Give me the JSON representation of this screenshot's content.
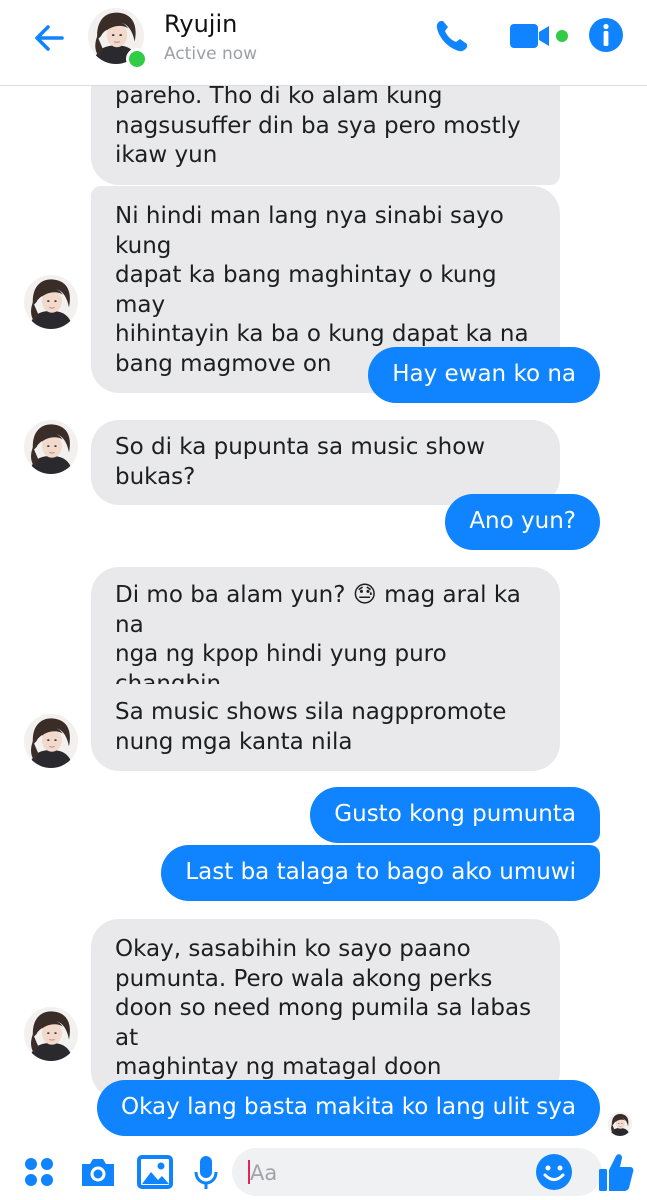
{
  "header": {
    "name": "Ryujin",
    "status": "Active now",
    "accent": "#0f84fe",
    "online_color": "#31cc46"
  },
  "messages": [
    {
      "side": "in",
      "text": "pareho. Tho di ko alam kung\nnagsusuffer din ba sya pero mostly\nikaw yun"
    },
    {
      "side": "in",
      "text": "Ni hindi man lang nya sinabi sayo kung\ndapat ka bang maghintay o kung may\nhihintayin ka ba o kung dapat ka na\nbang magmove on"
    },
    {
      "side": "out",
      "text": "Hay ewan ko na"
    },
    {
      "side": "in",
      "text": "So di ka pupunta sa music show bukas?"
    },
    {
      "side": "out",
      "text": "Ano yun?"
    },
    {
      "side": "in",
      "text_before": "Di mo ba alam yun? ",
      "emoji": "😓",
      "text_after": " mag aral ka na\nnga ng kpop hindi yung puro changbin\nlang"
    },
    {
      "side": "in",
      "text": "Sa music shows sila nagppromote\nnung mga kanta nila"
    },
    {
      "side": "out",
      "text": "Gusto kong pumunta"
    },
    {
      "side": "out",
      "text": "Last ba talaga to bago ako umuwi"
    },
    {
      "side": "in",
      "text": "Okay, sasabihin ko sayo paano\npumunta. Pero wala akong perks\ndoon so need mong pumila sa labas at\nmaghintay ng matagal doon"
    },
    {
      "side": "out",
      "text": "Okay lang basta makita ko lang ulit sya"
    }
  ],
  "composer": {
    "placeholder": "Aa"
  },
  "icons": {
    "back": "back-arrow-icon",
    "call": "phone-icon",
    "video": "video-camera-icon",
    "info": "info-icon",
    "apps": "apps-grid-icon",
    "camera": "camera-icon",
    "gallery": "image-icon",
    "mic": "microphone-icon",
    "emoji": "emoji-icon",
    "like": "thumbs-up-icon"
  }
}
